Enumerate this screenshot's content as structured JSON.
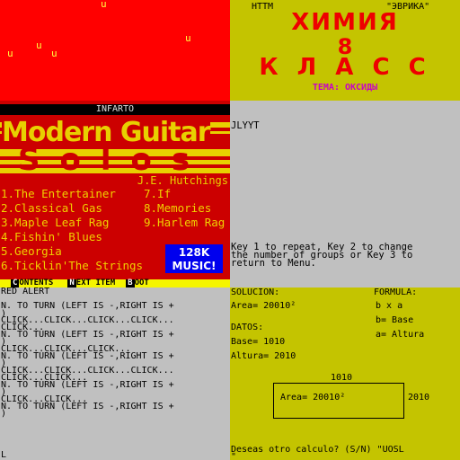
{
  "red_screen": {
    "glyphs": [
      "u",
      "u",
      "u",
      "u",
      "u"
    ]
  },
  "guitar_solos": {
    "publisher": "INFARTO",
    "logo_line1": "Modern Guitar",
    "logo_line2": "Solos",
    "author": "J.E. Hutchings",
    "tracks_left": [
      "1.The Entertainer",
      "2.Classical Gas",
      "3.Maple Leaf Rag",
      "4.Fishin' Blues",
      "5.Georgia",
      "6.Ticklin'The Strings"
    ],
    "tracks_right": [
      "7.If",
      "8.Memories",
      "9.Harlem Rag"
    ],
    "badge_line1": "128K",
    "badge_line2": "MUSIC!",
    "menu": {
      "contents_key": "C",
      "contents_label": "ONTENTS",
      "next_key": "N",
      "next_label": "EXT  ITEM",
      "boot_key": "B",
      "boot_label": "OOT"
    },
    "colors": {
      "bg": "#cc0000",
      "text": "#f0d000",
      "badge": "#0000ee",
      "menu_bar": "#f5f500"
    }
  },
  "khimiya": {
    "publisher_left": "НТТМ",
    "publisher_right": "\"ЭВРИКА\"",
    "title_line1": "ХИМИЯ",
    "title_line2": "8",
    "title_line3": "К Л А С С",
    "theme": "ТЕМА: ОКСИДЫ",
    "colors": {
      "bg": "#c4c400",
      "title": "#ee0000",
      "theme": "#c800c8"
    }
  },
  "message_screen": {
    "header": "JLYYT",
    "body_line1": "Key 1 to repeat, Key 2 to change",
    "body_line2": "the number of groups or Key 3 to",
    "body_line3": "return to Menu."
  },
  "red_alert": {
    "title": "RED ALERT",
    "lines": [
      "N. TO TURN (LEFT IS -,RIGHT IS +",
      ")",
      "CLICK...CLICK...CLICK...CLICK...",
      "CLICK...",
      "N. TO TURN (LEFT IS -,RIGHT IS +",
      ")",
      "CLICK...CLICK...CLICK...",
      "N. TO TURN (LEFT IS -,RIGHT IS +",
      ")",
      "CLICK...CLICK...CLICK...CLICK...",
      "CLICK...CLICK...",
      "N. TO TURN (LEFT IS -,RIGHT IS +",
      ")",
      "CLICK...CLICK...",
      "N. TO TURN (LEFT IS -,RIGHT IS +",
      ")"
    ],
    "cursor": "L"
  },
  "solucion": {
    "solucion_label": "SOLUCION:",
    "area_result": "Area= 20010²",
    "datos_label": "DATOS:",
    "base": "Base= 1010",
    "altura": "Altura= 2010",
    "formula_label": "FORMULA:",
    "formula": "b x a",
    "legend_b": "b= Base",
    "legend_a": "a= Altura",
    "diagram_top": "1010",
    "diagram_area": "Area= 20010²",
    "diagram_right": "2010",
    "prompt": "Deseas otro calculo? (S/N) \"UOSL",
    "prompt_tail": "\""
  }
}
